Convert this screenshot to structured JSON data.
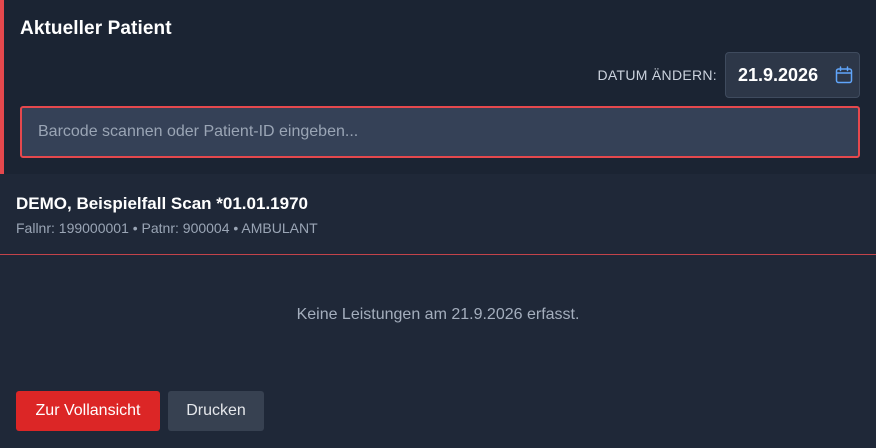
{
  "current_patient": {
    "title": "Aktueller Patient",
    "date_label": "DATUM ÄNDERN:",
    "date_value": "21.9.2026",
    "barcode_placeholder": "Barcode scannen oder Patient-ID eingeben..."
  },
  "patient": {
    "name": "DEMO, Beispielfall Scan *01.01.1970",
    "meta": "Fallnr: 199000001 • Patnr: 900004 • AMBULANT"
  },
  "services": {
    "empty_message": "Keine Leistungen am 21.9.2026 erfasst."
  },
  "actions": {
    "full_view_label": "Zur Vollansicht",
    "print_label": "Drucken"
  },
  "icons": {
    "calendar": "calendar-icon"
  },
  "colors": {
    "accent_red": "#e5484d",
    "primary_button": "#dc2626",
    "secondary_button": "#374151",
    "calendar_icon": "#60a5fa"
  }
}
